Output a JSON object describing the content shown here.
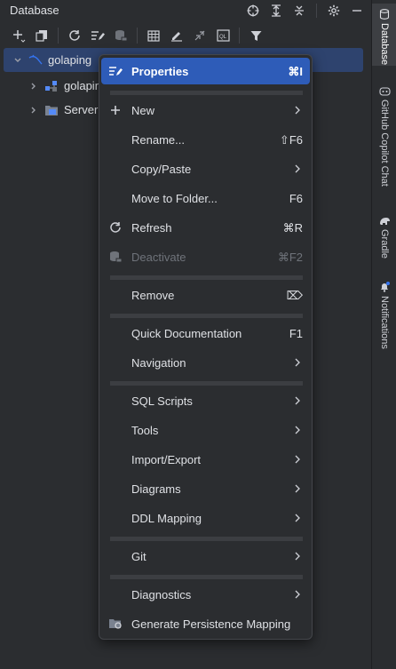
{
  "panel": {
    "title": "Database"
  },
  "header_icons": [
    "crosshair-icon",
    "expand-all-icon",
    "collapse-all-icon",
    "gear-icon",
    "minimize-icon"
  ],
  "toolbar_icons": [
    "add-icon",
    "copy-icon",
    "refresh-icon",
    "edit-properties-icon",
    "deactivate-icon",
    "table-icon",
    "edit-icon",
    "jump-icon",
    "console-icon",
    "filter-icon"
  ],
  "tree": {
    "root": {
      "label": "golaping"
    },
    "children": [
      {
        "label": "golapin"
      },
      {
        "label": "Server"
      }
    ]
  },
  "stripe": {
    "database": "Database",
    "copilot": "GitHub Copilot Chat",
    "gradle": "Gradle",
    "notifications": "Notifications"
  },
  "menu": {
    "items": [
      {
        "label": "Properties",
        "shortcut": "⌘I",
        "icon": "properties-icon",
        "highlighted": true
      },
      {
        "label": "New",
        "shortcut": "",
        "icon": "plus-icon",
        "submenu": true
      },
      {
        "label": "Rename...",
        "shortcut": "⇧F6"
      },
      {
        "label": "Copy/Paste",
        "shortcut": "",
        "submenu": true
      },
      {
        "label": "Move to Folder...",
        "shortcut": "F6"
      },
      {
        "label": "Refresh",
        "shortcut": "⌘R",
        "icon": "refresh-icon"
      },
      {
        "label": "Deactivate",
        "shortcut": "⌘F2",
        "icon": "deactivate-icon",
        "disabled": true
      },
      {
        "label": "Remove",
        "shortcut": "⌦"
      },
      {
        "label": "Quick Documentation",
        "shortcut": "F1"
      },
      {
        "label": "Navigation",
        "shortcut": "",
        "submenu": true
      },
      {
        "label": "SQL Scripts",
        "shortcut": "",
        "submenu": true
      },
      {
        "label": "Tools",
        "shortcut": "",
        "submenu": true
      },
      {
        "label": "Import/Export",
        "shortcut": "",
        "submenu": true
      },
      {
        "label": "Diagrams",
        "shortcut": "",
        "submenu": true
      },
      {
        "label": "DDL Mapping",
        "shortcut": "",
        "submenu": true
      },
      {
        "label": "Git",
        "shortcut": "",
        "submenu": true
      },
      {
        "label": "Diagnostics",
        "shortcut": "",
        "submenu": true
      },
      {
        "label": "Generate Persistence Mapping",
        "shortcut": "",
        "icon": "persistence-icon"
      }
    ]
  },
  "colors": {
    "background": "#2b2d30",
    "highlight": "#2e5cb8",
    "selection": "#2e436e",
    "accent": "#3574f0"
  }
}
